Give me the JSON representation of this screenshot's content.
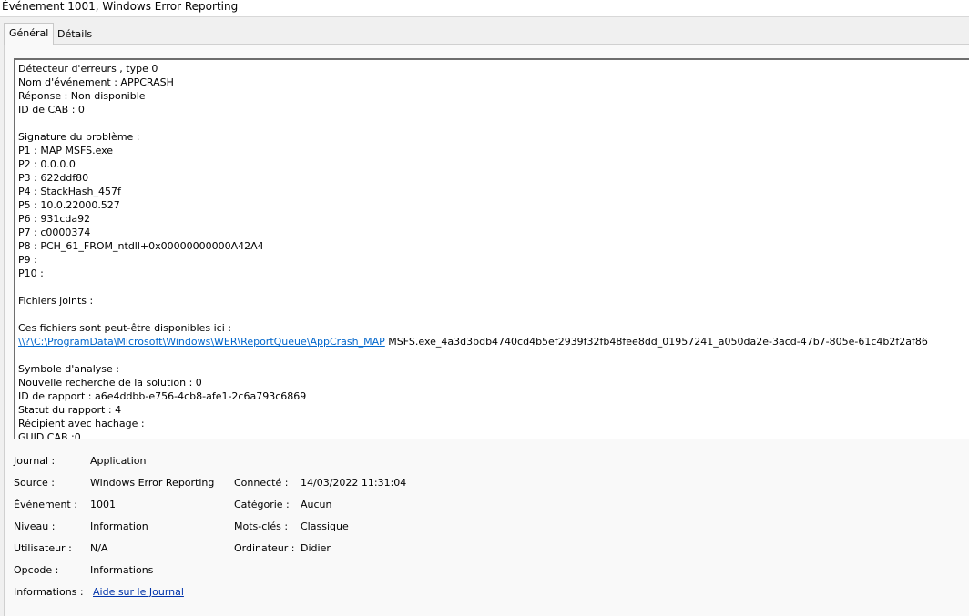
{
  "window": {
    "title": "Événement 1001, Windows Error Reporting"
  },
  "tabs": [
    {
      "label": "Général",
      "active": true
    },
    {
      "label": "Détails",
      "active": false
    }
  ],
  "description": {
    "lines": [
      "Détecteur d'erreurs , type 0",
      "Nom d'événement : APPCRASH",
      "Réponse : Non disponible",
      "ID de CAB : 0",
      "",
      "Signature du problème :",
      "P1 : MAP MSFS.exe",
      "P2 : 0.0.0.0",
      "P3 : 622ddf80",
      "P4 : StackHash_457f",
      "P5 : 10.0.22000.527",
      "P6 : 931cda92",
      "P7 : c0000374",
      "P8 : PCH_61_FROM_ntdll+0x00000000000A42A4",
      "P9 :",
      "P10 :",
      "",
      "Fichiers joints :",
      "",
      "Ces fichiers sont peut-être disponibles ici :",
      "",
      "",
      "Symbole d'analyse :",
      "Nouvelle recherche de la solution : 0",
      "ID de rapport : a6e4ddbb-e756-4cb8-afe1-2c6a793c6869",
      "Statut du rapport : 4",
      "Récipient avec hachage :",
      "GUID CAB :0"
    ],
    "path_link": "\\\\?\\C:\\ProgramData\\Microsoft\\Windows\\WER\\ReportQueue\\AppCrash_MAP",
    "path_suffix": "MSFS.exe_4a3d3bdb4740cd4b5ef2939f32fb48fee8dd_01957241_a050da2e-3acd-47b7-805e-61c4b2f2af86"
  },
  "properties": {
    "journal_label": "Journal :",
    "journal_value": "Application",
    "source_label": "Source :",
    "source_value": "Windows Error Reporting",
    "connecte_label": "Connecté :",
    "connecte_value": "14/03/2022 11:31:04",
    "evenement_label": "Événement :",
    "evenement_value": "1001",
    "categorie_label": "Catégorie :",
    "categorie_value": "Aucun",
    "niveau_label": "Niveau :",
    "niveau_value": "Information",
    "motscles_label": "Mots-clés :",
    "motscles_value": "Classique",
    "utilisateur_label": "Utilisateur :",
    "utilisateur_value": "N/A",
    "ordinateur_label": "Ordinateur :",
    "ordinateur_value": "Didier",
    "opcode_label": "Opcode :",
    "opcode_value": "Informations",
    "informations_label": "Informations :",
    "informations_link": "Aide sur le Journal"
  }
}
